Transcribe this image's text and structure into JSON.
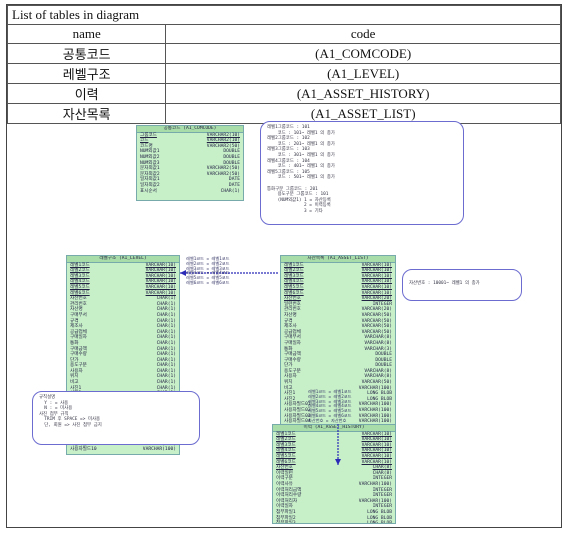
{
  "table": {
    "title": "List of tables in diagram",
    "col_name": "name",
    "col_code": "code",
    "rows": [
      {
        "name": "공통코드",
        "code": "(A1_COMCODE)"
      },
      {
        "name": "레벨구조",
        "code": "(A1_LEVEL)"
      },
      {
        "name": "이력",
        "code": "(A1_ASSET_HISTORY)"
      },
      {
        "name": "자산목록",
        "code": "(A1_ASSET_LIST)"
      }
    ]
  },
  "diagram": {
    "comcode": {
      "header": "공통코드 (A1_COMCODE)",
      "rows": [
        [
          "그룹코드",
          "VARCHAR2(10)",
          true
        ],
        [
          "코드",
          "VARCHAR2(10)",
          true
        ],
        [
          "코드명",
          "VARCHAR2(50)",
          false
        ],
        [
          "NUM외값1",
          "DOUBLE",
          false
        ],
        [
          "NUM외값2",
          "DOUBLE",
          false
        ],
        [
          "NUM외값3",
          "DOUBLE",
          false
        ],
        [
          "문자외값1",
          "VARCHAR2(50)",
          false
        ],
        [
          "문자외값2",
          "VARCHAR2(50)",
          false
        ],
        [
          "일자외값1",
          "DATE",
          false
        ],
        [
          "일자외값2",
          "DATE",
          false
        ],
        [
          "표시순서",
          "CHAR(1)",
          false
        ]
      ]
    },
    "level": {
      "header": "레벨구조 (A1_LEVEL)",
      "rows": [
        [
          "레벨1코드",
          "VARCHAR(10)",
          true
        ],
        [
          "레벨2코드",
          "VARCHAR(10)",
          true
        ],
        [
          "레벨3코드",
          "VARCHAR(10)",
          true
        ],
        [
          "레벨4코드",
          "VARCHAR(10)",
          true
        ],
        [
          "레벨5코드",
          "VARCHAR(10)",
          true
        ],
        [
          "레벨6코드",
          "VARCHAR(10)",
          true
        ],
        [
          "자산번호",
          "CHAR(1)",
          false
        ],
        [
          "관리번호",
          "CHAR(1)",
          false
        ],
        [
          "자산명",
          "CHAR(1)",
          false
        ],
        [
          "구매부서",
          "CHAR(1)",
          false
        ],
        [
          "규격",
          "CHAR(1)",
          false
        ],
        [
          "제조사",
          "CHAR(1)",
          false
        ],
        [
          "공급업체",
          "CHAR(1)",
          false
        ],
        [
          "구매일자",
          "CHAR(1)",
          false
        ],
        [
          "통화",
          "CHAR(1)",
          false
        ],
        [
          "구매금액",
          "CHAR(1)",
          false
        ],
        [
          "구매수량",
          "CHAR(1)",
          false
        ],
        [
          "단가",
          "CHAR(1)",
          false
        ],
        [
          "용도구분",
          "CHAR(1)",
          false
        ],
        [
          "사용자",
          "CHAR(1)",
          false
        ],
        [
          "위치",
          "CHAR(1)",
          false
        ],
        [
          "비고",
          "CHAR(1)",
          false
        ],
        [
          "사진1",
          "CHAR(1)",
          false
        ],
        [
          "사진2",
          "CHAR(1)",
          false
        ],
        [
          "사용자필드01",
          "VARCHAR(100)",
          false
        ],
        [
          "사용자필드02",
          "VARCHAR(100)",
          false
        ],
        [
          "사용자필드03",
          "VARCHAR(100)",
          false
        ],
        [
          "사용자필드04",
          "VARCHAR(100)",
          false
        ],
        [
          "사용자필드05",
          "VARCHAR(100)",
          false
        ],
        [
          "사용자필드06",
          "VARCHAR(100)",
          false
        ],
        [
          "사용자필드07",
          "VARCHAR(100)",
          false
        ],
        [
          "사용자필드08",
          "VARCHAR(100)",
          false
        ],
        [
          "사용자필드09",
          "VARCHAR(100)",
          false
        ],
        [
          "사용자필드10",
          "VARCHAR(100)",
          false
        ]
      ]
    },
    "list": {
      "header": "자산목록 (A1_ASSET_LIST)",
      "rows": [
        [
          "레벨1코드",
          "VARCHAR(10)",
          true
        ],
        [
          "레벨2코드",
          "VARCHAR(10)",
          true
        ],
        [
          "레벨3코드",
          "VARCHAR(10)",
          true
        ],
        [
          "레벨4코드",
          "VARCHAR(10)",
          true
        ],
        [
          "레벨5코드",
          "VARCHAR(10)",
          true
        ],
        [
          "레벨6코드",
          "VARCHAR(10)",
          true
        ],
        [
          "자산번호",
          "VARCHAR(20)",
          true
        ],
        [
          "일련번호",
          "INTEGER",
          false
        ],
        [
          "관리번호",
          "VARCHAR(20)",
          false
        ],
        [
          "자산명",
          "VARCHAR(50)",
          false
        ],
        [
          "규격",
          "VARCHAR(50)",
          false
        ],
        [
          "제조사",
          "VARCHAR(50)",
          false
        ],
        [
          "공급업체",
          "VARCHAR(50)",
          false
        ],
        [
          "구매부서",
          "VARCHAR(8)",
          false
        ],
        [
          "구매일자",
          "VARCHAR(8)",
          false
        ],
        [
          "통화",
          "VARCHAR(3)",
          false
        ],
        [
          "구매금액",
          "DOUBLE",
          false
        ],
        [
          "구매수량",
          "DOUBLE",
          false
        ],
        [
          "단가",
          "DOUBLE",
          false
        ],
        [
          "용도구분",
          "VARCHAR(8)",
          false
        ],
        [
          "사용자",
          "VARCHAR(8)",
          false
        ],
        [
          "위치",
          "VARCHAR(50)",
          false
        ],
        [
          "비고",
          "VARCHAR(100)",
          false
        ],
        [
          "사진1",
          "LONG BLOB",
          false
        ],
        [
          "사진2",
          "LONG BLOB",
          false
        ],
        [
          "사용자필드01",
          "VARCHAR(100)",
          false
        ],
        [
          "사용자필드02",
          "VARCHAR(100)",
          false
        ],
        [
          "사용자필드03",
          "VARCHAR(100)",
          false
        ],
        [
          "사용자필드04",
          "VARCHAR(100)",
          false
        ],
        [
          "사용자필드05",
          "VARCHAR(100)",
          false
        ],
        [
          "사용자필드06",
          "VARCHAR(100)",
          false
        ],
        [
          "사용자필드07",
          "VARCHAR(100)",
          false
        ],
        [
          "사용자필드08",
          "VARCHAR(100)",
          false
        ],
        [
          "사용자필드09",
          "VARCHAR(100)",
          false
        ],
        [
          "사용자필드10",
          "VARCHAR(100)",
          false
        ]
      ]
    },
    "history": {
      "header": "이력 (A1_ASSET_HISTORY)",
      "rows": [
        [
          "레벨1코드",
          "VARCHAR(10)",
          true
        ],
        [
          "레벨2코드",
          "VARCHAR(10)",
          true
        ],
        [
          "레벨3코드",
          "VARCHAR(10)",
          true
        ],
        [
          "레벨4코드",
          "VARCHAR(10)",
          true
        ],
        [
          "레벨5코드",
          "VARCHAR(10)",
          true
        ],
        [
          "레벨6코드",
          "VARCHAR(10)",
          true
        ],
        [
          "자산번호",
          "CHAR(8)",
          true
        ],
        [
          "이력일련",
          "CHAR(8)",
          false
        ],
        [
          "이력구분",
          "INTEGER",
          false
        ],
        [
          "이력사유",
          "VARCHAR(100)",
          false
        ],
        [
          "이력처리금액",
          "INTEGER",
          false
        ],
        [
          "이력처리수량",
          "INTEGER",
          false
        ],
        [
          "이력처리자",
          "VARCHAR(100)",
          false
        ],
        [
          "이력일자",
          "INTEGER",
          false
        ],
        [
          "첨부파일1",
          "LONG BLOB",
          false
        ],
        [
          "첨부파일2",
          "LONG BLOB",
          false
        ],
        [
          "첨부파일3",
          "LONG BLOB",
          false
        ]
      ]
    },
    "note_top": "레벨1그룹코드 : 101\n    코드 : 101~ 레벨1 의 종가\n레벨2그룹코드 : 102\n    코드 : 201~ 레벨1 의 종가\n레벨3그룹코드 : 103\n    코드 : 301~ 레벨1 의 종가\n레벨4그룹코드 : 104\n    코드 : 401~ 레벨1 의 종가\n레벨5그룹코드 : 105\n    코드 : 501~ 레벨1 의 종가\n\n통화구분 그룹코드 : 201\n    용도구분 그룹코드 : 101\n    (NUM외값1) 1 = 자산등록\n              2 = 이력등록\n              3 = 기타",
    "note_right": "자산번호 : 10001~ 레벨1 의 종가",
    "note_bottom": "규칙설명\n  Y : = 사용\n  N : = 미사용\n사진 첨부 규칙\n  TRIM 후 SPACE => 미사용\n  단, 회원 => 사진 첨부 금지",
    "link_level_list": "레벨1코드 = 레벨1코드\n레벨2코드 = 레벨2코드\n레벨3코드 = 레벨3코드\n레벨4코드 = 레벨4코드\n레벨5코드 = 레벨5코드\n레벨6코드 = 레벨6코드",
    "link_list_history": "레벨1코드 = 레벨1코드\n레벨2코드 = 레벨2코드\n레벨3코드 = 레벨3코드\n레벨4코드 = 레벨4코드\n레벨5코드 = 레벨5코드\n레벨6코드 = 레벨6코드\n자산번호 = 자산번호"
  },
  "colors": {
    "entity": "#c8f0c8",
    "note_border": "#6b6bd0",
    "arrow": "#2b2bb8"
  }
}
